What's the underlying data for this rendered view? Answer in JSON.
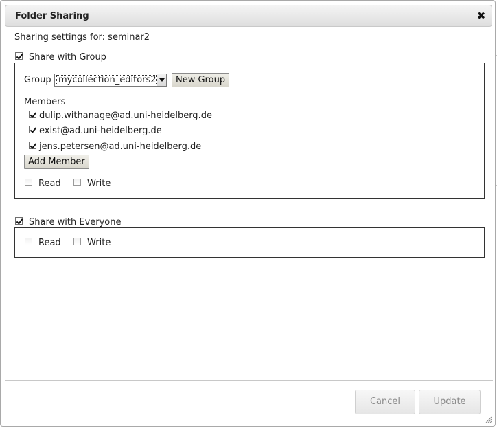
{
  "dialog": {
    "title": "Folder Sharing",
    "close_icon": "close-icon"
  },
  "sharing_for": "Sharing settings for: seminar2",
  "group_section": {
    "checkbox_label": "Share with Group",
    "checked": true,
    "group_label": "Group",
    "selected_group": "mycollection_editors2",
    "new_group_label": "New Group",
    "members_label": "Members",
    "members": [
      {
        "email": "dulip.withanage@ad.uni-heidelberg.de",
        "checked": true
      },
      {
        "email": "exist@ad.uni-heidelberg.de",
        "checked": true
      },
      {
        "email": "jens.petersen@ad.uni-heidelberg.de",
        "checked": true
      }
    ],
    "add_member_label": "Add Member",
    "read_label": "Read",
    "write_label": "Write",
    "read_checked": false,
    "write_checked": false
  },
  "everyone_section": {
    "checkbox_label": "Share with Everyone",
    "checked": true,
    "read_label": "Read",
    "write_label": "Write",
    "read_checked": false,
    "write_checked": false
  },
  "footer": {
    "cancel_label": "Cancel",
    "update_label": "Update"
  }
}
